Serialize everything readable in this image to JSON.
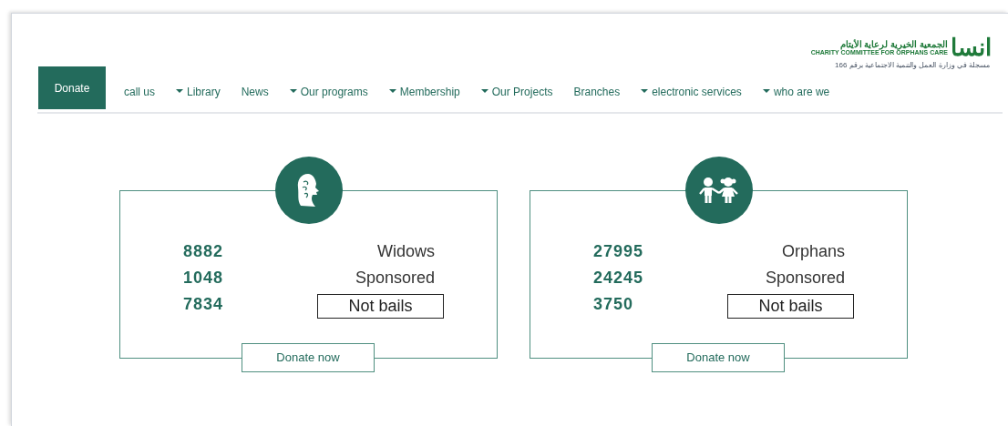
{
  "logo": {
    "mark": "انسا",
    "name_ar": "الجمعية الخيرية لرعاية الأيتام",
    "name_en": "CHARITY COMMITTEE FOR ORPHANS CARE",
    "registration": "مسجلة في وزارة العمل والتنمية الاجتماعية برقم 166"
  },
  "nav": [
    {
      "label": "Donate",
      "kind": "button",
      "has_menu": false
    },
    {
      "label": "call us",
      "kind": "link",
      "has_menu": false
    },
    {
      "label": "Library",
      "kind": "link",
      "has_menu": true
    },
    {
      "label": "News",
      "kind": "link",
      "has_menu": false
    },
    {
      "label": "Our programs",
      "kind": "link",
      "has_menu": true
    },
    {
      "label": "Membership",
      "kind": "link",
      "has_menu": true
    },
    {
      "label": "Our Projects",
      "kind": "link",
      "has_menu": true
    },
    {
      "label": "Branches",
      "kind": "link",
      "has_menu": false
    },
    {
      "label": "electronic services",
      "kind": "link",
      "has_menu": true
    },
    {
      "label": "who are we",
      "kind": "link",
      "has_menu": true
    }
  ],
  "cards": [
    {
      "kind": "widows",
      "stats": [
        {
          "value": "8882",
          "label": "Widows",
          "boxed": false
        },
        {
          "value": "1048",
          "label": "Sponsored",
          "boxed": false
        },
        {
          "value": "7834",
          "label": "Not bails",
          "boxed": true
        }
      ],
      "button": "Donate now"
    },
    {
      "kind": "orphans",
      "stats": [
        {
          "value": "27995",
          "label": "Orphans",
          "boxed": false
        },
        {
          "value": "24245",
          "label": "Sponsored",
          "boxed": false
        },
        {
          "value": "3750",
          "label": "Not bails",
          "boxed": true
        }
      ],
      "button": "Donate now"
    }
  ]
}
